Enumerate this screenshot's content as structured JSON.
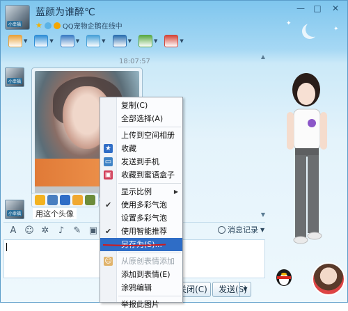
{
  "contact": {
    "nickname": "蓝颜为谁醉℃",
    "status": "QQ宠物企鹅在线中",
    "avatar_tag": "小幸福"
  },
  "window_controls": [
    "—",
    "□",
    "✕"
  ],
  "toolbar": {
    "items": [
      {
        "icon": "microphone-icon",
        "color": "#e8a23b"
      },
      {
        "icon": "camera-icon",
        "color": "#2f8ed6"
      },
      {
        "icon": "remote-desktop-icon",
        "color": "#3b7cc4"
      },
      {
        "icon": "file-transfer-icon",
        "color": "#48a1d8"
      },
      {
        "icon": "screen-share-icon",
        "color": "#2c6fb0"
      },
      {
        "icon": "sms-icon",
        "color": "#5aa943"
      },
      {
        "icon": "apps-icon",
        "color": "#d4463a"
      }
    ]
  },
  "chat": {
    "timestamp": "18:07:57",
    "image_overlay_text": "小幸",
    "message_text": "用这个头像",
    "message_icons": [
      {
        "icon": "emoji-icon",
        "color": "#f3b220"
      },
      {
        "icon": "save-icon",
        "color": "#4a7fc0"
      },
      {
        "icon": "favorite-icon",
        "color": "#2f6dc6"
      },
      {
        "icon": "face-icon",
        "color": "#f0a830"
      },
      {
        "icon": "more-icon",
        "color": "#6c8c3a"
      }
    ]
  },
  "input_toolbar": {
    "icons": [
      "font-icon",
      "emoji-icon",
      "shake-icon",
      "voice-icon",
      "edit-icon",
      "image-icon"
    ],
    "history_label": "消息记录"
  },
  "buttons": {
    "close": "关闭(C)",
    "send": "发送(S)"
  },
  "context_menu": {
    "items": [
      {
        "label": "复制(C)",
        "state": "normal",
        "icon": ""
      },
      {
        "label": "全部选择(A)",
        "state": "normal",
        "icon": ""
      },
      {
        "sep": true
      },
      {
        "label": "上传到空间相册",
        "state": "normal",
        "icon": ""
      },
      {
        "label": "收藏",
        "state": "normal",
        "icon": "star-icon"
      },
      {
        "label": "发送到手机",
        "state": "normal",
        "icon": "phone-icon"
      },
      {
        "label": "收藏到蜜语盒子",
        "state": "normal",
        "icon": "box-icon"
      },
      {
        "sep": true
      },
      {
        "label": "显示比例",
        "state": "normal",
        "icon": "",
        "submenu": true
      },
      {
        "label": "使用多彩气泡",
        "state": "checked",
        "icon": ""
      },
      {
        "label": "设置多彩气泡",
        "state": "normal",
        "icon": ""
      },
      {
        "label": "使用智能推荐",
        "state": "checked",
        "icon": ""
      },
      {
        "label": "另存为(S)...",
        "state": "active",
        "icon": ""
      },
      {
        "sep": true
      },
      {
        "label": "从原创表情添加",
        "state": "disabled",
        "icon": "face-icon"
      },
      {
        "label": "添加到表情(E)",
        "state": "normal",
        "icon": ""
      },
      {
        "label": "涂鸦编辑",
        "state": "normal",
        "icon": ""
      },
      {
        "sep": true
      },
      {
        "label": "举报此图片",
        "state": "normal",
        "icon": ""
      }
    ]
  },
  "colors": {
    "menu_highlight": "#2f6dc6",
    "title_gradient_top": "#7fc6ee",
    "annotation_red": "#d21a1a"
  }
}
